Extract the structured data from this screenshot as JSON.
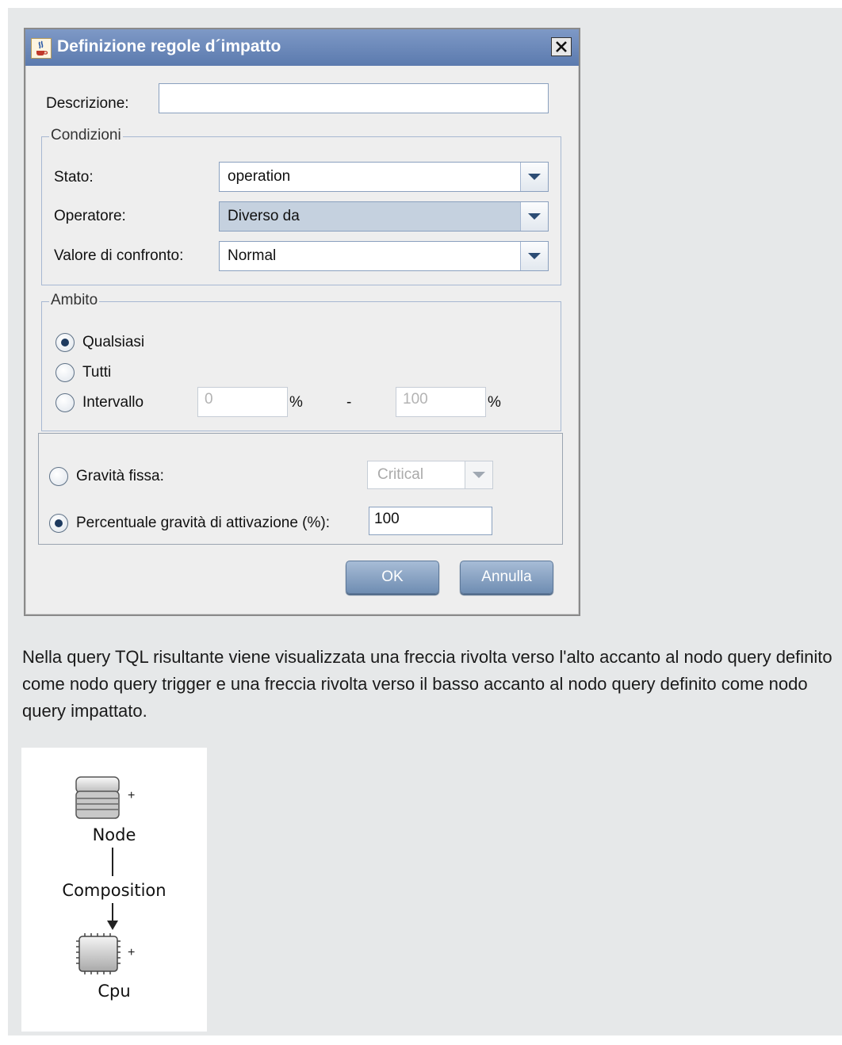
{
  "dialog": {
    "title": "Definizione regole d´impatto",
    "description_label": "Descrizione:",
    "description_value": "",
    "conditions": {
      "legend": "Condizioni",
      "stato_label": "Stato:",
      "stato_value": "operation",
      "operatore_label": "Operatore:",
      "operatore_value": "Diverso da",
      "valore_label": "Valore di confronto:",
      "valore_value": "Normal"
    },
    "scope": {
      "legend": "Ambito",
      "option_any": "Qualsiasi",
      "option_all": "Tutti",
      "option_range": "Intervallo",
      "range_from": "0",
      "range_to": "100",
      "percent": "%",
      "dash": "-",
      "selected": "Qualsiasi"
    },
    "severity": {
      "fixed_label": "Gravità fissa:",
      "fixed_value": "Critical",
      "percent_label": "Percentuale gravità di attivazione (%):",
      "percent_value": "100",
      "selected": "percent"
    },
    "ok_label": "OK",
    "cancel_label": "Annulla"
  },
  "paragraph": "Nella query TQL risultante viene visualizzata una freccia rivolta verso l'alto accanto al nodo query definito come nodo query trigger e una freccia rivolta verso il basso accanto al nodo query definito come nodo query impattato.",
  "diagram": {
    "node1_label": "Node",
    "relation_label": "Composition",
    "node2_label": "Cpu",
    "node1_marker": "+",
    "node2_marker": "+"
  }
}
